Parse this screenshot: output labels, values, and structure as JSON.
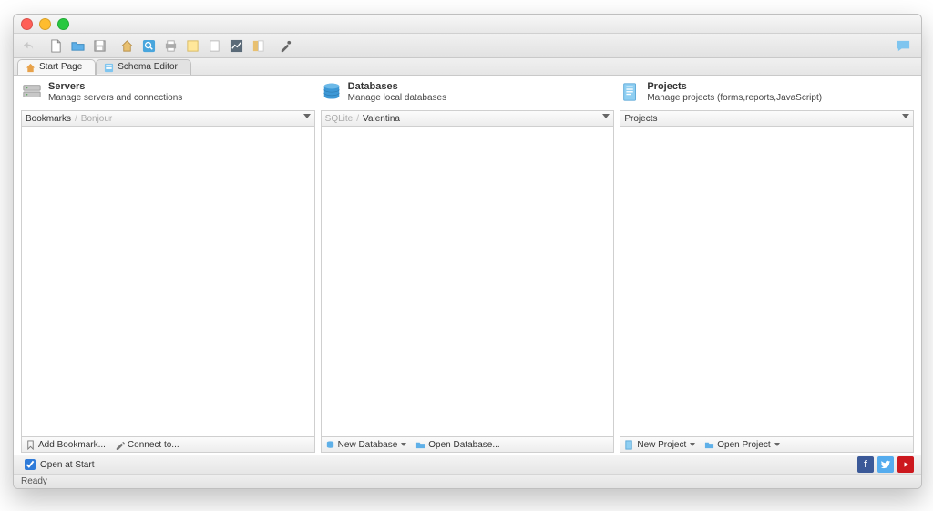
{
  "tabs": [
    {
      "label": "Start Page"
    },
    {
      "label": "Schema Editor"
    }
  ],
  "columns": {
    "servers": {
      "title": "Servers",
      "subtitle": "Manage servers and connections",
      "crumbs": [
        "Bookmarks",
        "Bonjour"
      ],
      "actions": [
        "Add Bookmark...",
        "Connect to..."
      ]
    },
    "databases": {
      "title": "Databases",
      "subtitle": "Manage local databases",
      "crumbs": [
        "SQLite",
        "Valentina"
      ],
      "actions": [
        "New Database",
        "Open Database..."
      ]
    },
    "projects": {
      "title": "Projects",
      "subtitle": "Manage projects (forms,reports,JavaScript)",
      "crumbs": [
        "Projects"
      ],
      "actions": [
        "New Project",
        "Open Project"
      ]
    }
  },
  "footer": {
    "open_at_start": "Open at Start",
    "open_at_start_checked": true
  },
  "status": "Ready"
}
